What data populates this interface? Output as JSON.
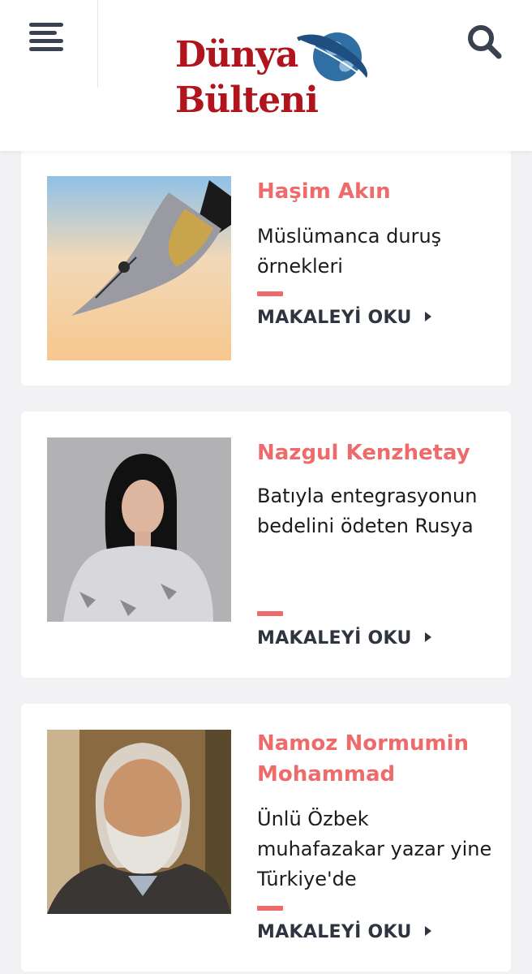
{
  "header": {
    "logo_line1": "Dünya",
    "logo_line2": "Bülteni",
    "menu_icon": "hamburger-menu-icon",
    "search_icon": "search-icon",
    "brand_color": "#b0141c"
  },
  "accent_color": "#ee6b6b",
  "articles": [
    {
      "author": "Haşim Akın",
      "title": "Müslümanca duruş örnekleri",
      "read_more": "MAKALEYİ OKU",
      "image": "fountain-pen-nib"
    },
    {
      "author": "Nazgul Kenzhetay",
      "title": "Batıyla entegrasyonun bedelini ödeten Rusya",
      "read_more": "MAKALEYİ OKU",
      "image": "author-portrait-woman"
    },
    {
      "author": "Namoz Normumin Mohammad",
      "title": "Ünlü Özbek muhafazakar yazar yine Türkiye'de",
      "read_more": "MAKALEYİ OKU",
      "image": "author-portrait-man"
    }
  ]
}
